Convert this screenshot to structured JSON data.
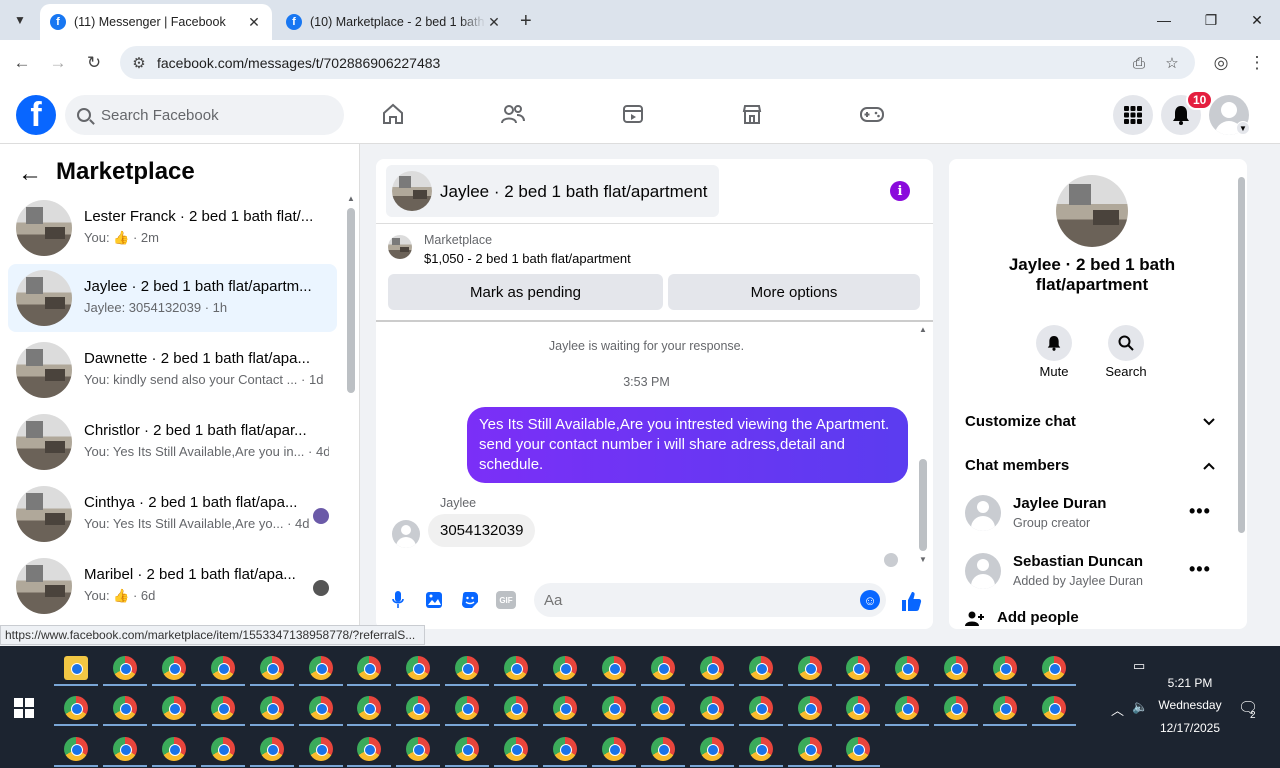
{
  "browser": {
    "tabs": [
      {
        "favicon": "facebook-favicon",
        "title": "(11) Messenger | Facebook",
        "active": true
      },
      {
        "favicon": "facebook-favicon",
        "title": "(10) Marketplace - 2 bed 1 bath",
        "active": false
      }
    ],
    "url": "facebook.com/messages/t/702886906227483"
  },
  "fb": {
    "search_placeholder": "Search Facebook",
    "notif_count": "10"
  },
  "left": {
    "title": "Marketplace",
    "conversations": [
      {
        "name": "Lester Franck · 2 bed 1 bath flat/...",
        "snippet": "You: 👍 · 2m",
        "selected": false
      },
      {
        "name": "Jaylee · 2 bed 1 bath flat/apartm...",
        "snippet": "Jaylee: 3054132039 · 1h",
        "selected": true
      },
      {
        "name": "Dawnette · 2 bed 1 bath flat/apa...",
        "snippet": "You: kindly send also your Contact ... · 1d",
        "selected": false
      },
      {
        "name": "Christlor · 2 bed 1 bath flat/apar...",
        "snippet": "You: Yes Its Still Available,Are you in... · 4d",
        "selected": false
      },
      {
        "name": "Cinthya · 2 bed 1 bath flat/apa...",
        "snippet": "You: Yes Its Still Available,Are yo... · 4d",
        "selected": false
      },
      {
        "name": "Maribel · 2 bed 1 bath flat/apa...",
        "snippet": "You: 👍 · 6d",
        "selected": false
      }
    ]
  },
  "chat": {
    "title": "Jaylee · 2 bed 1 bath flat/apartment",
    "listing_source": "Marketplace",
    "listing_price": "$1,050 - 2 bed 1 bath flat/apartment",
    "btn_pending": "Mark as pending",
    "btn_more": "More options",
    "system_msg": "Jaylee is waiting for your response.",
    "time": "3:53 PM",
    "outgoing": "Yes Its Still Available,Are you intrested viewing the Apartment. send your contact number i will share adress,detail and schedule.",
    "sender": "Jaylee",
    "incoming": "3054132039",
    "input_placeholder": "Aa"
  },
  "right": {
    "name": "Jaylee · 2 bed 1 bath flat/apartment",
    "mute": "Mute",
    "search": "Search",
    "customize": "Customize chat",
    "members_title": "Chat members",
    "members": [
      {
        "name": "Jaylee Duran",
        "role": "Group creator"
      },
      {
        "name": "Sebastian Duncan",
        "role": "Added by Jaylee Duran"
      }
    ],
    "add_people": "Add people"
  },
  "status_url": "https://www.facebook.com/marketplace/item/1553347138958778/?referralS...",
  "taskbar": {
    "time": "5:21 PM",
    "day": "Wednesday",
    "date": "12/17/2025",
    "notif_count": "2"
  },
  "colors": {
    "fb_blue": "#0866ff",
    "bubble_purple": "#7b2ff7",
    "selected_row": "#ebf5ff",
    "badge_red": "#e41e3f"
  }
}
